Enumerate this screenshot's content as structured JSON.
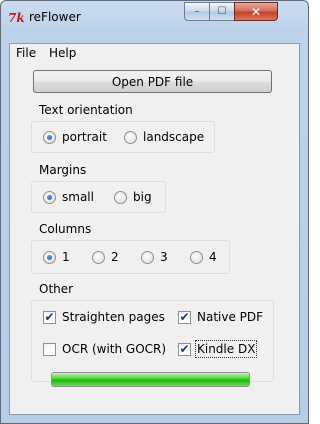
{
  "window": {
    "title": "reFlower",
    "icon_glyph": "7k",
    "close_glyph": "✕",
    "max_glyph": "☐",
    "min_glyph": "–"
  },
  "menu": [
    {
      "label": "File"
    },
    {
      "label": "Help"
    }
  ],
  "open_button": {
    "label": "Open PDF file"
  },
  "text_orientation": {
    "label": "Text orientation",
    "options": [
      {
        "label": "portrait",
        "selected": true
      },
      {
        "label": "landscape",
        "selected": false
      }
    ]
  },
  "margins": {
    "label": "Margins",
    "options": [
      {
        "label": "small",
        "selected": true
      },
      {
        "label": "big",
        "selected": false
      }
    ]
  },
  "columns": {
    "label": "Columns",
    "options": [
      {
        "label": "1",
        "selected": true
      },
      {
        "label": "2",
        "selected": false
      },
      {
        "label": "3",
        "selected": false
      },
      {
        "label": "4",
        "selected": false
      }
    ]
  },
  "other": {
    "label": "Other",
    "checkboxes": [
      {
        "label": "Straighten pages",
        "checked": true
      },
      {
        "label": "Native PDF",
        "checked": true
      },
      {
        "label": "OCR (with GOCR)",
        "checked": false
      },
      {
        "label": "Kindle DX",
        "checked": true
      }
    ]
  },
  "progress": {
    "value": 1.0,
    "color": "#3cc72a"
  },
  "check_glyph": "✔"
}
